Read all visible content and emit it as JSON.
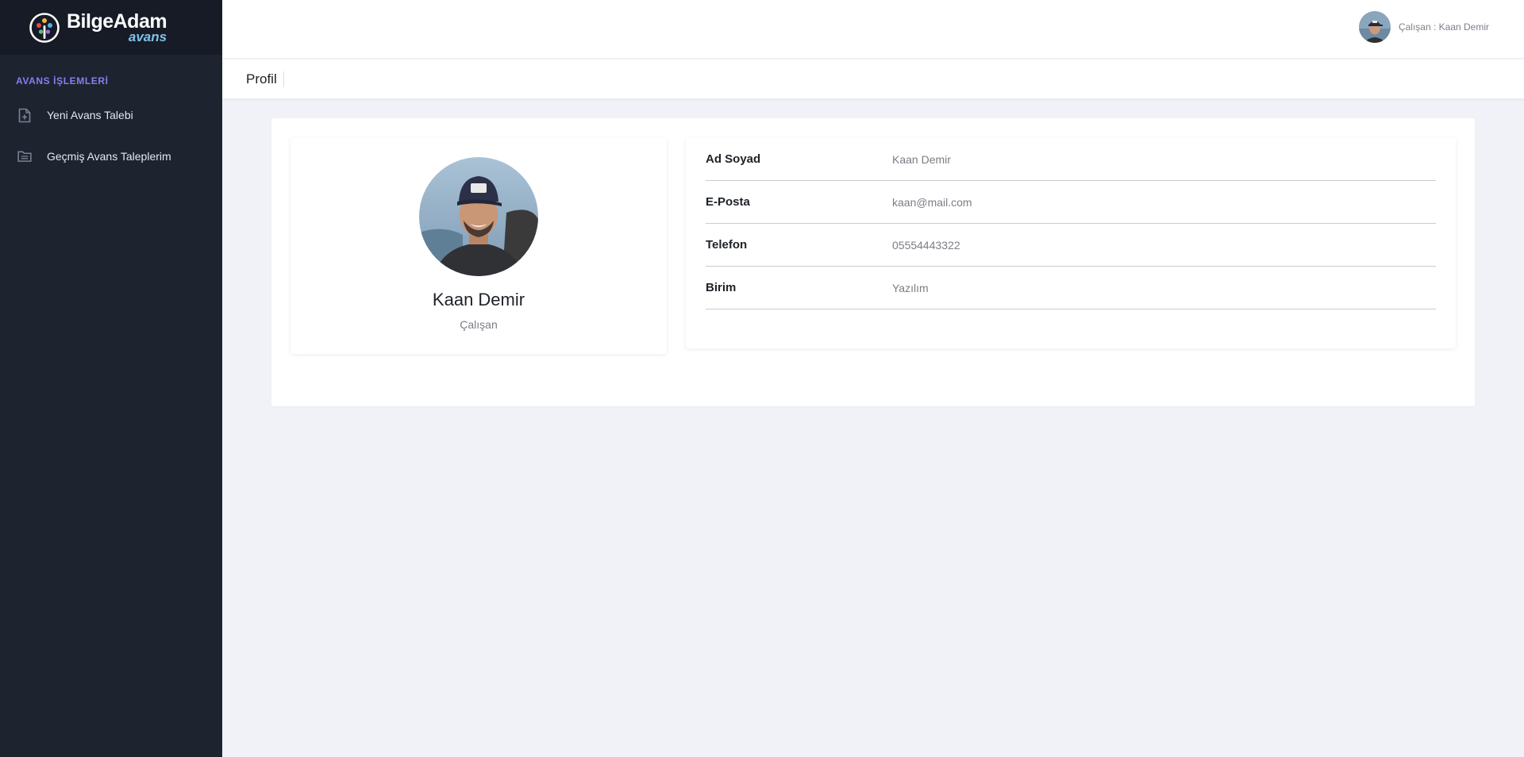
{
  "brand": {
    "name": "BilgeAdam",
    "sub": "avans"
  },
  "sidebar": {
    "section_title": "AVANS İŞLEMLERİ",
    "items": [
      {
        "label": "Yeni Avans Talebi",
        "icon": "file-plus-icon"
      },
      {
        "label": "Geçmiş Avans Taleplerim",
        "icon": "folder-icon"
      }
    ]
  },
  "header": {
    "user_label": "Çalışan : Kaan Demir"
  },
  "page": {
    "title": "Profil"
  },
  "profile": {
    "name": "Kaan Demir",
    "role": "Çalışan",
    "fields": [
      {
        "label": "Ad Soyad",
        "value": "Kaan Demir"
      },
      {
        "label": "E-Posta",
        "value": "kaan@mail.com"
      },
      {
        "label": "Telefon",
        "value": "05554443322"
      },
      {
        "label": "Birim",
        "value": "Yazılım"
      }
    ]
  },
  "colors": {
    "sidebar_bg": "#1e2330",
    "brand_bg": "#171b26",
    "section_title": "#8a7cf0",
    "content_bg": "#f0f2f7"
  }
}
